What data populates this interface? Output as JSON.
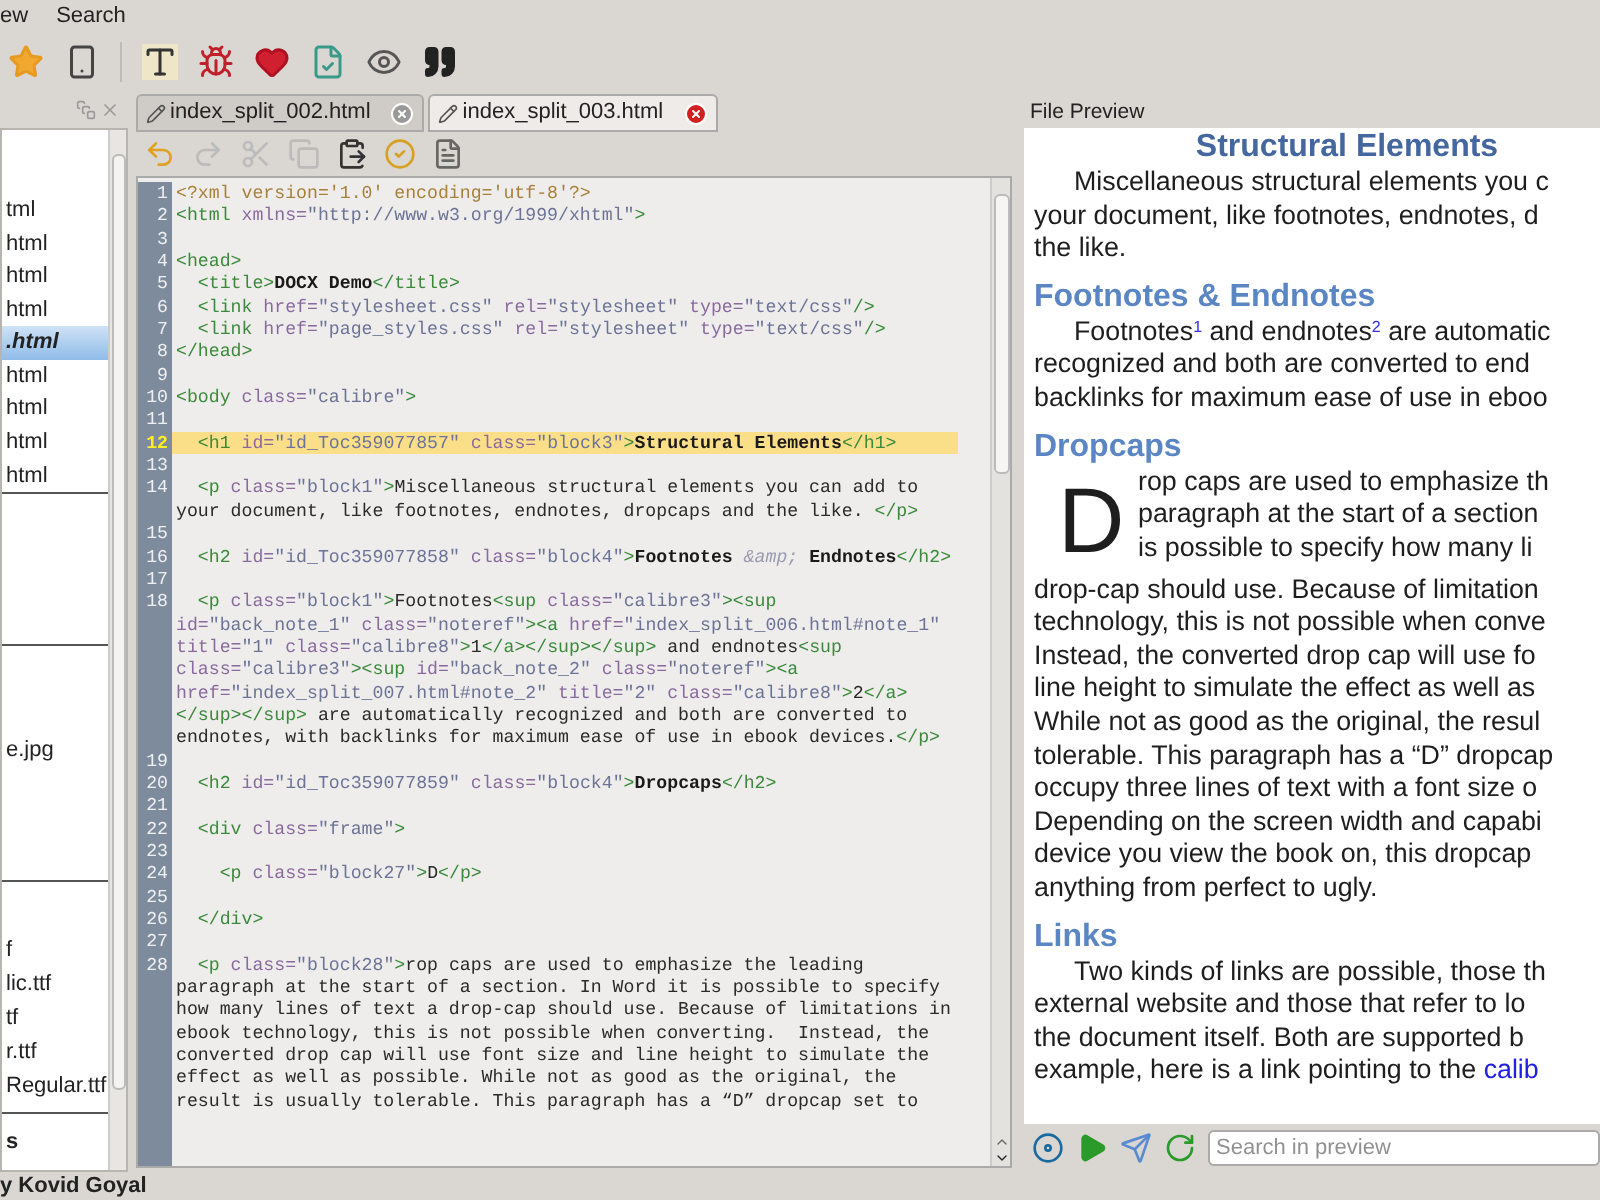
{
  "menu": [
    "ew",
    "Search"
  ],
  "sidebar": {
    "sections": [
      {
        "items": [
          {
            "name": "tml",
            "selected": false
          },
          {
            "name": "html",
            "selected": false
          },
          {
            "name": "html",
            "selected": false
          },
          {
            "name": "html",
            "selected": false
          },
          {
            "name": ".html",
            "selected": true
          },
          {
            "name": "html",
            "selected": false
          },
          {
            "name": "html",
            "selected": false
          },
          {
            "name": "html",
            "selected": false
          },
          {
            "name": "html",
            "selected": false
          }
        ]
      },
      {
        "items": [
          {
            "name": "e.jpg",
            "selected": false
          }
        ]
      },
      {
        "items": [
          {
            "name": "f",
            "selected": false
          },
          {
            "name": "lic.ttf",
            "selected": false
          },
          {
            "name": "tf",
            "selected": false
          },
          {
            "name": "r.ttf",
            "selected": false
          },
          {
            "name": "Regular.ttf",
            "selected": false
          }
        ]
      }
    ],
    "footer": "s"
  },
  "tabs": [
    {
      "label": "index_split_002.html",
      "selected": false
    },
    {
      "label": "index_split_003.html",
      "selected": true
    }
  ],
  "editor_toolbar": [
    {
      "kind": "undo",
      "disabled": false
    },
    {
      "kind": "redo",
      "disabled": true
    },
    {
      "kind": "cut",
      "disabled": true
    },
    {
      "kind": "copy",
      "disabled": true
    },
    {
      "kind": "paste",
      "disabled": false
    },
    {
      "kind": "check",
      "disabled": false
    },
    {
      "kind": "list",
      "disabled": false
    }
  ],
  "editor": {
    "lines": [
      {
        "number": "1",
        "highlighted": false,
        "segments": [
          {
            "kind": "pi",
            "text": "<?xml version='1.0' encoding='utf-8'?>"
          }
        ]
      },
      {
        "number": "2",
        "highlighted": false,
        "segments": [
          {
            "kind": "tag",
            "text": "<html"
          },
          {
            "kind": "attr",
            "text": " xmlns="
          },
          {
            "kind": "value",
            "text": "\"http://www.w3.org/1999/xhtml\""
          },
          {
            "kind": "tag",
            "text": ">"
          }
        ]
      },
      {
        "number": "3",
        "highlighted": false
      },
      {
        "number": "4",
        "highlighted": false,
        "segments": [
          {
            "kind": "tag",
            "text": "<head>"
          }
        ]
      },
      {
        "number": "5",
        "highlighted": false,
        "segments": [
          {
            "kind": "tag",
            "text": "  <title>"
          },
          {
            "kind": "heading",
            "text": "DOCX Demo"
          },
          {
            "kind": "tag",
            "text": "</title>"
          }
        ]
      },
      {
        "number": "6",
        "highlighted": false,
        "segments": [
          {
            "kind": "tag",
            "text": "  <link"
          },
          {
            "kind": "attr",
            "text": " href="
          },
          {
            "kind": "value",
            "text": "\"stylesheet.css\""
          },
          {
            "kind": "attr",
            "text": " rel="
          },
          {
            "kind": "value",
            "text": "\"stylesheet\""
          },
          {
            "kind": "attr",
            "text": " type="
          },
          {
            "kind": "value",
            "text": "\"text/css\""
          },
          {
            "kind": "tag",
            "text": "/>"
          }
        ]
      },
      {
        "number": "7",
        "highlighted": false,
        "segments": [
          {
            "kind": "tag",
            "text": "  <link"
          },
          {
            "kind": "attr",
            "text": " href="
          },
          {
            "kind": "value",
            "text": "\"page_styles.css\""
          },
          {
            "kind": "attr",
            "text": " rel="
          },
          {
            "kind": "value",
            "text": "\"stylesheet\""
          },
          {
            "kind": "attr",
            "text": " type="
          },
          {
            "kind": "value",
            "text": "\"text/css\""
          },
          {
            "kind": "tag",
            "text": "/>"
          }
        ]
      },
      {
        "number": "8",
        "highlighted": false,
        "segments": [
          {
            "kind": "tag",
            "text": "</head>"
          }
        ]
      },
      {
        "number": "9",
        "highlighted": false
      },
      {
        "number": "10",
        "highlighted": false,
        "segments": [
          {
            "kind": "tag",
            "text": "<body"
          },
          {
            "kind": "attr",
            "text": " class="
          },
          {
            "kind": "value",
            "text": "\"calibre\""
          },
          {
            "kind": "tag",
            "text": ">"
          }
        ]
      },
      {
        "number": "11",
        "highlighted": false
      },
      {
        "number": "12",
        "highlighted": true,
        "segments": [
          {
            "kind": "tag",
            "text": "  <h1"
          },
          {
            "kind": "attr",
            "text": " id="
          },
          {
            "kind": "value",
            "text": "\"id_Toc359077857\""
          },
          {
            "kind": "attr",
            "text": " class="
          },
          {
            "kind": "value",
            "text": "\"block3\""
          },
          {
            "kind": "tag",
            "text": ">"
          },
          {
            "kind": "heading",
            "text": "Structural Elements"
          },
          {
            "kind": "tag",
            "text": "</h1>"
          }
        ]
      },
      {
        "number": "13",
        "highlighted": false
      },
      {
        "number": "14",
        "highlighted": false,
        "segments": [
          {
            "kind": "tag",
            "text": "  <p"
          },
          {
            "kind": "attr",
            "text": " class="
          },
          {
            "kind": "value",
            "text": "\"block1\""
          },
          {
            "kind": "tag",
            "text": ">"
          },
          {
            "kind": "text",
            "text": "Miscellaneous structural elements you can add to your document, like footnotes, endnotes, dropcaps and the like. "
          },
          {
            "kind": "tag",
            "text": "</p>"
          }
        ]
      },
      {
        "number": "15",
        "highlighted": false
      },
      {
        "number": "16",
        "highlighted": false,
        "segments": [
          {
            "kind": "tag",
            "text": "  <h2"
          },
          {
            "kind": "attr",
            "text": " id="
          },
          {
            "kind": "value",
            "text": "\"id_Toc359077858\""
          },
          {
            "kind": "attr",
            "text": " class="
          },
          {
            "kind": "value",
            "text": "\"block4\""
          },
          {
            "kind": "tag",
            "text": ">"
          },
          {
            "kind": "heading",
            "text": "Footnotes "
          },
          {
            "kind": "entity",
            "text": "&amp;"
          },
          {
            "kind": "heading",
            "text": " Endnotes"
          },
          {
            "kind": "tag",
            "text": "</h2>"
          }
        ]
      },
      {
        "number": "17",
        "highlighted": false
      },
      {
        "number": "18",
        "highlighted": false,
        "segments": [
          {
            "kind": "tag",
            "text": "  <p"
          },
          {
            "kind": "attr",
            "text": " class="
          },
          {
            "kind": "value",
            "text": "\"block1\""
          },
          {
            "kind": "tag",
            "text": ">"
          },
          {
            "kind": "text",
            "text": "Footnotes"
          },
          {
            "kind": "tag",
            "text": "<sup"
          },
          {
            "kind": "attr",
            "text": " class="
          },
          {
            "kind": "value",
            "text": "\"calibre3\""
          },
          {
            "kind": "tag",
            "text": "><sup"
          },
          {
            "kind": "attr",
            "text": " id="
          },
          {
            "kind": "value",
            "text": "\"back_note_1\""
          },
          {
            "kind": "attr",
            "text": " class="
          },
          {
            "kind": "value",
            "text": "\"noteref\""
          },
          {
            "kind": "tag",
            "text": "><a"
          },
          {
            "kind": "attr",
            "text": " href="
          },
          {
            "kind": "value",
            "text": "\"index_split_006.html#note_1\""
          },
          {
            "kind": "attr",
            "text": " title="
          },
          {
            "kind": "value",
            "text": "\"1\""
          },
          {
            "kind": "attr",
            "text": " class="
          },
          {
            "kind": "value",
            "text": "\"calibre8\""
          },
          {
            "kind": "tag",
            "text": ">"
          },
          {
            "kind": "text",
            "text": "1"
          },
          {
            "kind": "tag",
            "text": "</a></sup></sup>"
          },
          {
            "kind": "text",
            "text": " and endnotes"
          },
          {
            "kind": "tag",
            "text": "<sup"
          },
          {
            "kind": "attr",
            "text": " class="
          },
          {
            "kind": "value",
            "text": "\"calibre3\""
          },
          {
            "kind": "tag",
            "text": "><sup"
          },
          {
            "kind": "attr",
            "text": " id="
          },
          {
            "kind": "value",
            "text": "\"back_note_2\""
          },
          {
            "kind": "attr",
            "text": " class="
          },
          {
            "kind": "value",
            "text": "\"noteref\""
          },
          {
            "kind": "tag",
            "text": "><a"
          },
          {
            "kind": "attr",
            "text": " href="
          },
          {
            "kind": "value",
            "text": "\"index_split_007.html#note_2\""
          },
          {
            "kind": "attr",
            "text": " title="
          },
          {
            "kind": "value",
            "text": "\"2\""
          },
          {
            "kind": "attr",
            "text": " class="
          },
          {
            "kind": "value",
            "text": "\"calibre8\""
          },
          {
            "kind": "tag",
            "text": ">"
          },
          {
            "kind": "text",
            "text": "2"
          },
          {
            "kind": "tag",
            "text": "</a></sup></sup>"
          },
          {
            "kind": "text",
            "text": " are automatically recognized and both are converted to endnotes, with backlinks for maximum ease of use in ebook devices."
          },
          {
            "kind": "tag",
            "text": "</p>"
          }
        ]
      },
      {
        "number": "19",
        "highlighted": false
      },
      {
        "number": "20",
        "highlighted": false,
        "segments": [
          {
            "kind": "tag",
            "text": "  <h2"
          },
          {
            "kind": "attr",
            "text": " id="
          },
          {
            "kind": "value",
            "text": "\"id_Toc359077859\""
          },
          {
            "kind": "attr",
            "text": " class="
          },
          {
            "kind": "value",
            "text": "\"block4\""
          },
          {
            "kind": "tag",
            "text": ">"
          },
          {
            "kind": "heading",
            "text": "Dropcaps"
          },
          {
            "kind": "tag",
            "text": "</h2>"
          }
        ]
      },
      {
        "number": "21",
        "highlighted": false
      },
      {
        "number": "22",
        "highlighted": false,
        "segments": [
          {
            "kind": "tag",
            "text": "  <div"
          },
          {
            "kind": "attr",
            "text": " class="
          },
          {
            "kind": "value",
            "text": "\"frame\""
          },
          {
            "kind": "tag",
            "text": ">"
          }
        ]
      },
      {
        "number": "23",
        "highlighted": false
      },
      {
        "number": "24",
        "highlighted": false,
        "segments": [
          {
            "kind": "tag",
            "text": "    <p"
          },
          {
            "kind": "attr",
            "text": " class="
          },
          {
            "kind": "value",
            "text": "\"block27\""
          },
          {
            "kind": "tag",
            "text": ">"
          },
          {
            "kind": "text",
            "text": "D"
          },
          {
            "kind": "tag",
            "text": "</p>"
          }
        ]
      },
      {
        "number": "25",
        "highlighted": false
      },
      {
        "number": "26",
        "highlighted": false,
        "segments": [
          {
            "kind": "tag",
            "text": "  </div>"
          }
        ]
      },
      {
        "number": "27",
        "highlighted": false
      },
      {
        "number": "28",
        "highlighted": false,
        "segments": [
          {
            "kind": "tag",
            "text": "  <p"
          },
          {
            "kind": "attr",
            "text": " class="
          },
          {
            "kind": "value",
            "text": "\"block28\""
          },
          {
            "kind": "tag",
            "text": ">"
          },
          {
            "kind": "text",
            "text": "rop caps are used to emphasize the leading paragraph at the start of a section. In Word it is possible to specify how many lines of text a drop-cap should use. Because of limitations in ebook technology, this is not possible when converting.  Instead, the converted drop cap will use font size and line height to simulate the effect as well as possible. While not as good as the original, the result is usually tolerable. This paragraph has a “D” dropcap set to"
          }
        ]
      }
    ]
  },
  "preview": {
    "title": "File Preview",
    "blocks": [
      {
        "kind": "title",
        "text": "Structural Elements"
      },
      {
        "kind": "paragraph",
        "lines": [
          "Miscellaneous structural elements you c",
          "your document, like footnotes, endnotes, d",
          "the like."
        ]
      },
      {
        "kind": "heading",
        "text": "Footnotes & Endnotes"
      },
      {
        "kind": "paragraph",
        "lines": [
          "Footnotes$^{1}$ and endnotes$^{2}$ are automatic",
          "recognized and both are converted to end",
          "backlinks for maximum ease of use in eboo"
        ]
      },
      {
        "kind": "heading",
        "text": "Dropcaps"
      },
      {
        "kind": "dropcap",
        "letter": "D",
        "beside": [
          "rop caps are used to emphasize th",
          "paragraph at the start of a section",
          "is possible to specify how many li"
        ],
        "lines": [
          "drop-cap should use. Because of limitation",
          "technology, this is not possible when conve",
          "Instead, the converted drop cap will use fo",
          "line height to simulate the effect as well as",
          "While not as good as the original, the resul",
          "tolerable. This paragraph has a “D” dropcap",
          "occupy three lines of text with a font size o",
          "Depending on the screen width and capabi",
          "device you view the book on, this dropcap",
          "anything from perfect to ugly."
        ]
      },
      {
        "kind": "heading",
        "text": "Links"
      },
      {
        "kind": "paragraph",
        "lines": [
          "Two kinds of links are possible, those th",
          "external website and those that refer to lo",
          "the document itself. Both are supported b",
          "example, here is a link pointing to the"
        ],
        "link": "calib"
      }
    ],
    "search": {
      "placeholder": "Search in preview"
    }
  },
  "status_bar": "y Kovid Goyal"
}
